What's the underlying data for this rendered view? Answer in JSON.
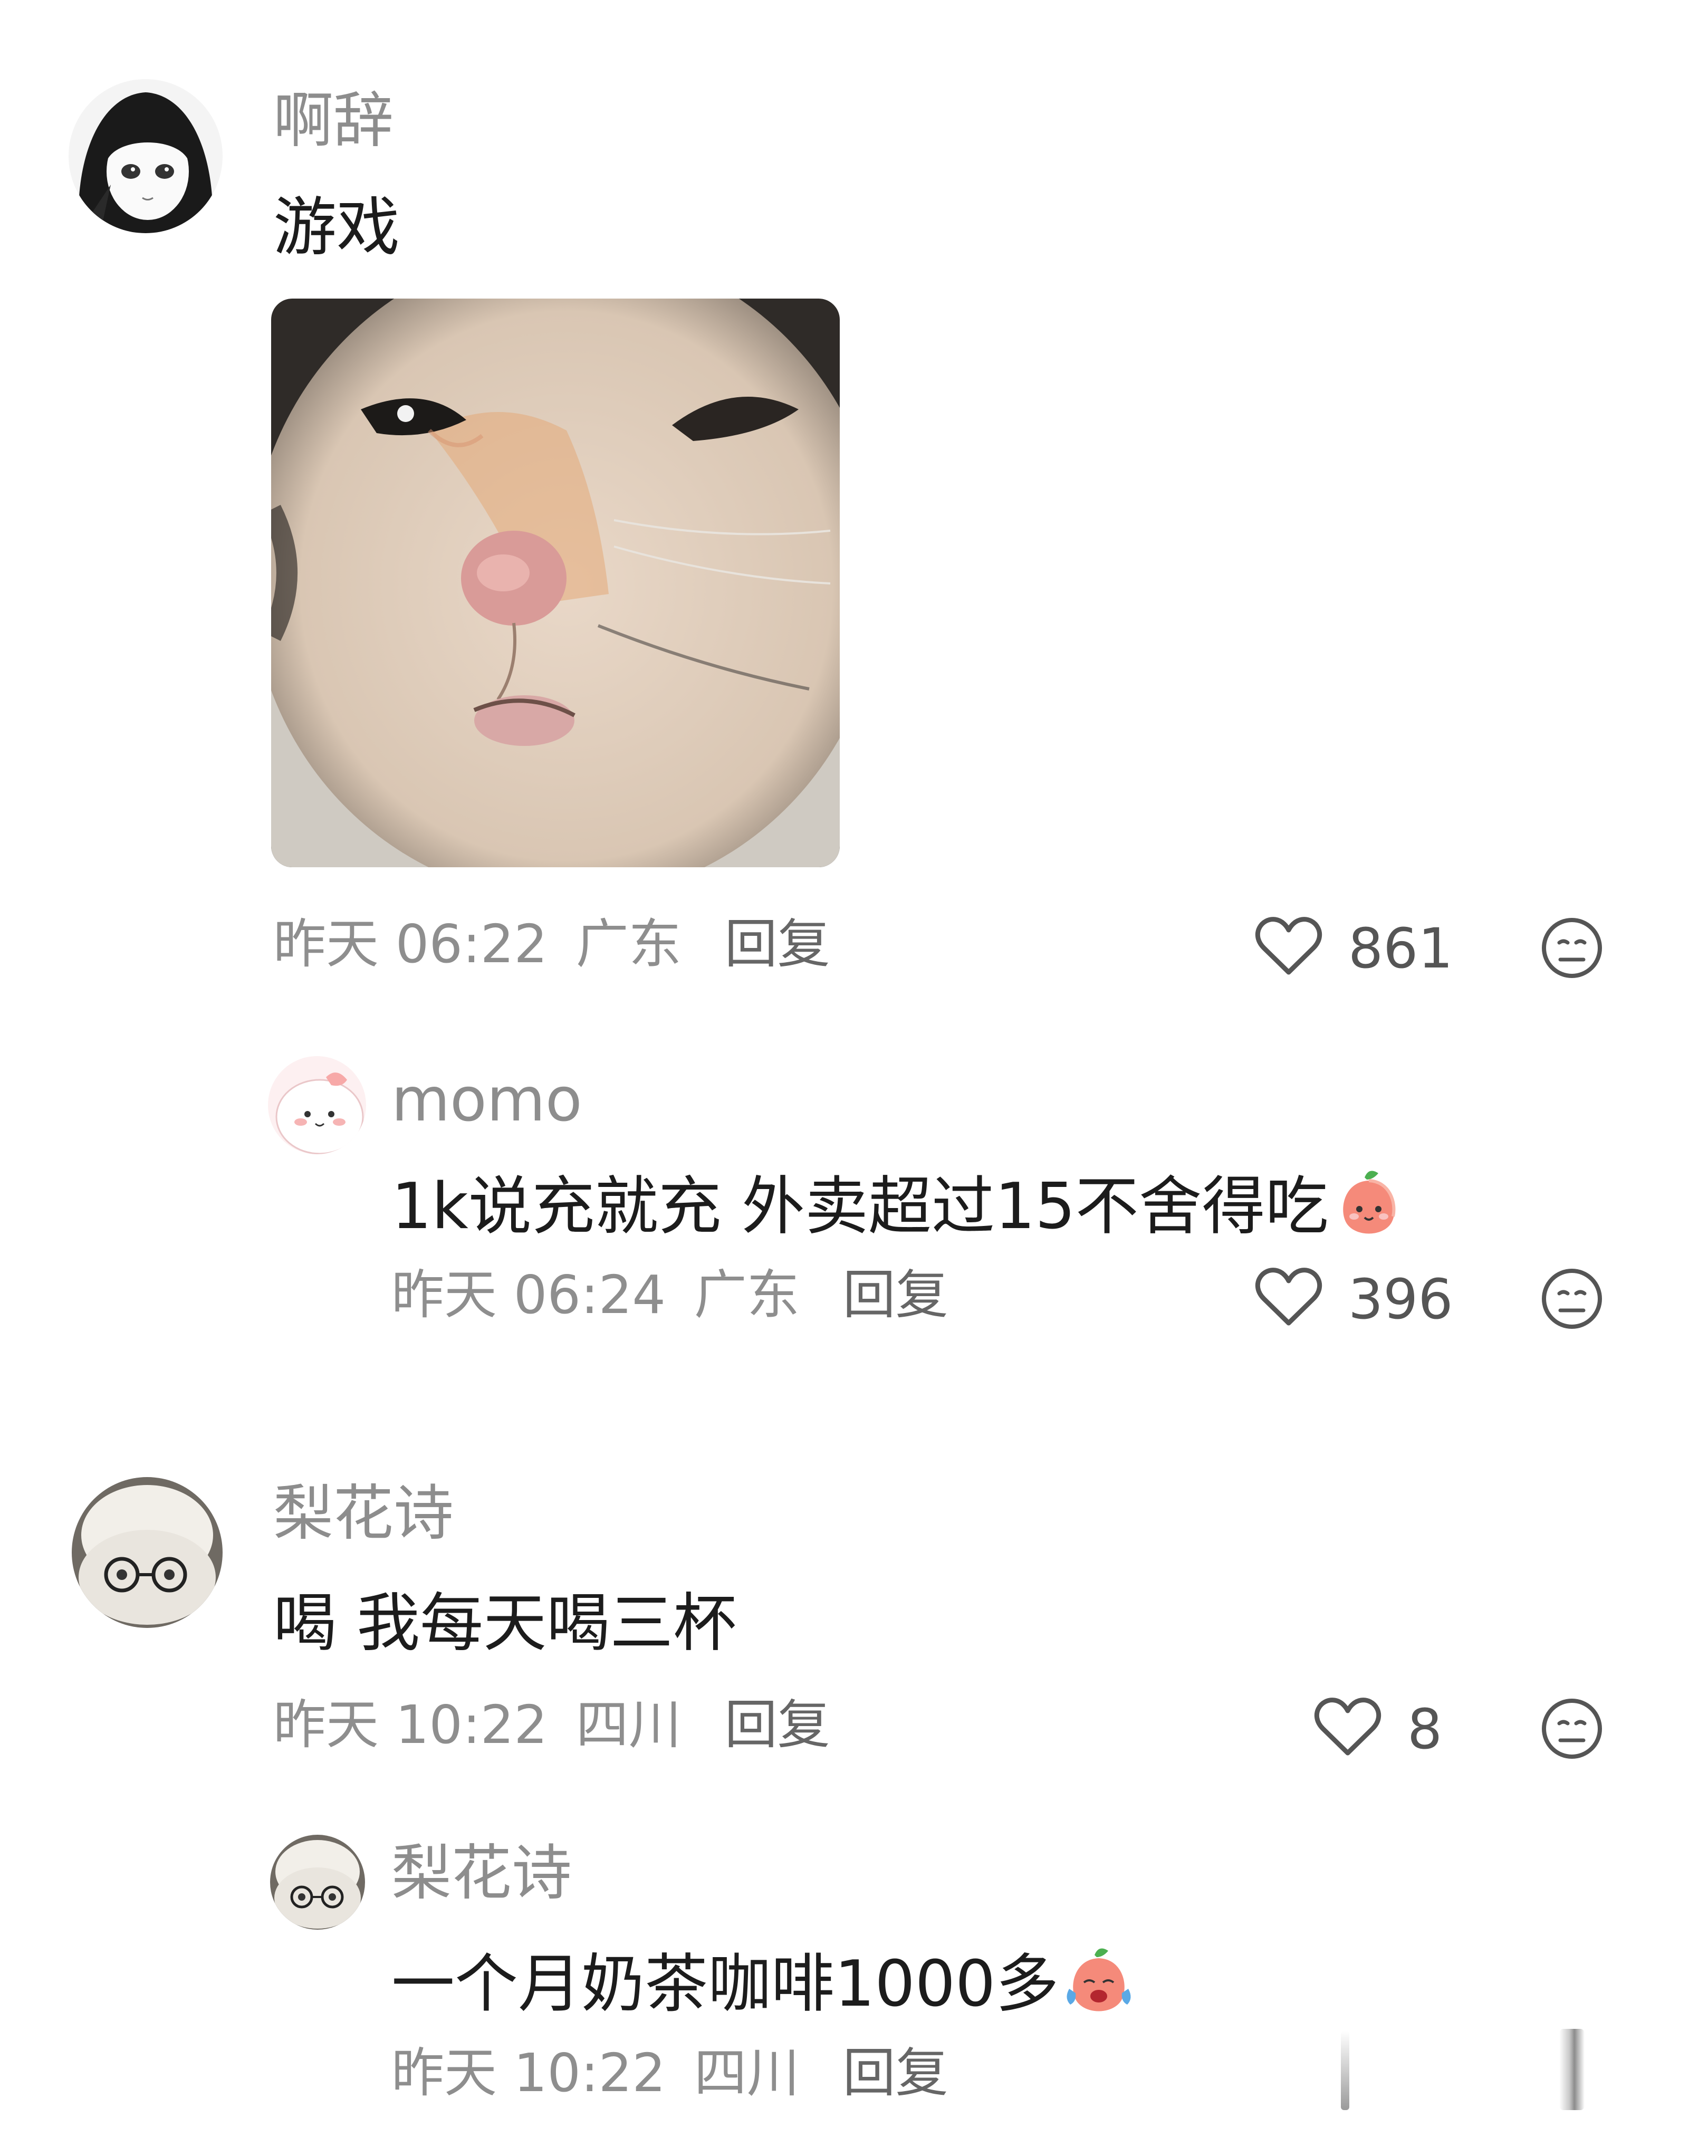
{
  "comments": [
    {
      "username": "啊辞",
      "text": "游戏",
      "has_image": true,
      "image_icon": "cat-meme-image",
      "time": "昨天 06:22",
      "location": "广东",
      "reply_label": "回复",
      "likes": "861",
      "reply": {
        "username": "momo",
        "text": "1k说充就充 外卖超过15不舍得吃",
        "emoji_icon": "smiling-peach-emoji",
        "time": "昨天 06:24",
        "location": "广东",
        "reply_label": "回复",
        "likes": "396"
      }
    },
    {
      "username": "梨花诗",
      "text": "喝 我每天喝三杯",
      "time": "昨天 10:22",
      "location": "四川",
      "reply_label": "回复",
      "likes": "8",
      "reply": {
        "username": "梨花诗",
        "text": "一个月奶茶咖啡1000多",
        "emoji_icon": "crying-peach-emoji",
        "time": "昨天 10:22",
        "location": "四川",
        "reply_label": "回复"
      }
    }
  ],
  "icons": {
    "like": "heart-outline-icon",
    "dislike": "meh-face-icon"
  }
}
